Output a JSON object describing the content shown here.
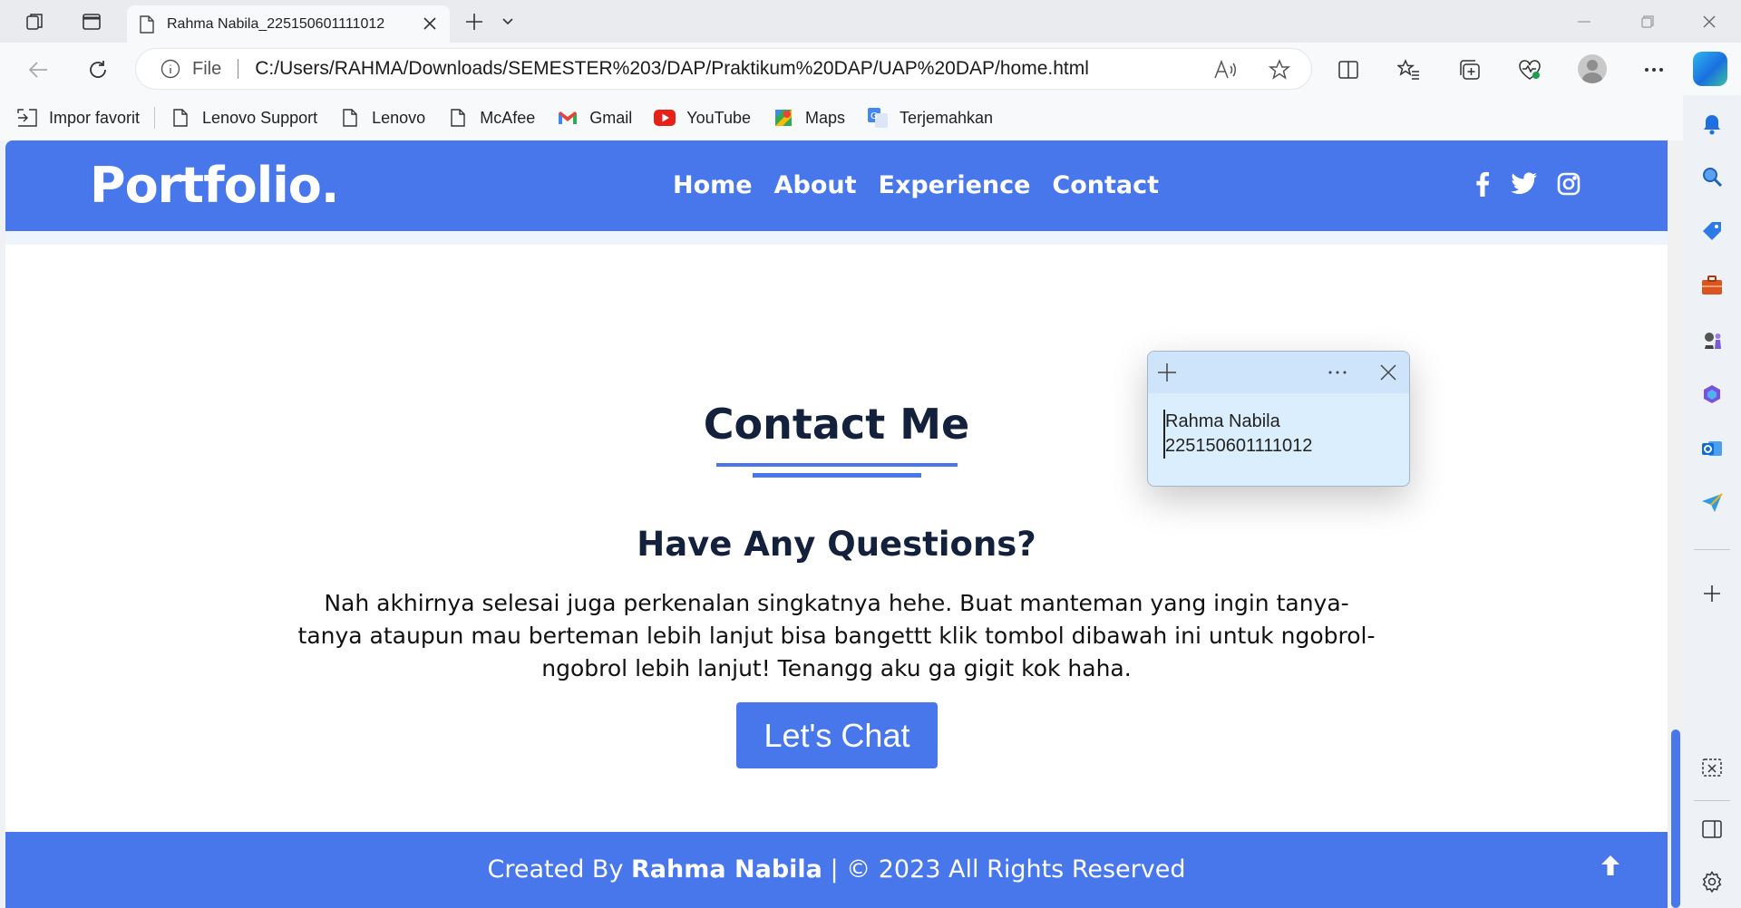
{
  "browser": {
    "tab": {
      "title": "Rahma Nabila_225150601111012"
    },
    "address": {
      "scheme": "File",
      "url": "C:/Users/RAHMA/Downloads/SEMESTER%203/DAP/Praktikum%20DAP/UAP%20DAP/home.html"
    },
    "favorites": [
      {
        "label": "Impor favorit",
        "icon": "import-icon"
      },
      {
        "label": "Lenovo Support",
        "icon": "page-icon"
      },
      {
        "label": "Lenovo",
        "icon": "page-icon"
      },
      {
        "label": "McAfee",
        "icon": "page-icon"
      },
      {
        "label": "Gmail",
        "icon": "gmail-icon"
      },
      {
        "label": "YouTube",
        "icon": "youtube-icon"
      },
      {
        "label": "Maps",
        "icon": "maps-icon"
      },
      {
        "label": "Terjemahkan",
        "icon": "translate-icon"
      }
    ]
  },
  "site": {
    "logo": "Portfolio.",
    "nav": [
      "Home",
      "About",
      "Experience",
      "Contact"
    ],
    "social": [
      "facebook-icon",
      "twitter-icon",
      "instagram-icon"
    ],
    "accent": "#4777ea",
    "contact": {
      "title": "Contact Me",
      "subtitle": "Have Any Questions?",
      "body": "Nah akhirnya selesai juga perkenalan singkatnya hehe. Buat manteman yang ingin tanya-tanya ataupun mau berteman lebih lanjut bisa bangettt klik tombol dibawah ini untuk ngobrol-ngobrol lebih lanjut! Tenangg aku ga gigit kok haha.",
      "button": "Let's Chat"
    },
    "footer": {
      "prefix": "Created By",
      "name": "Rahma Nabila",
      "suffix": "| © 2023 All Rights Reserved"
    }
  },
  "sticky_note": {
    "line1": "Rahma Nabila",
    "line2": "225150601111012"
  }
}
